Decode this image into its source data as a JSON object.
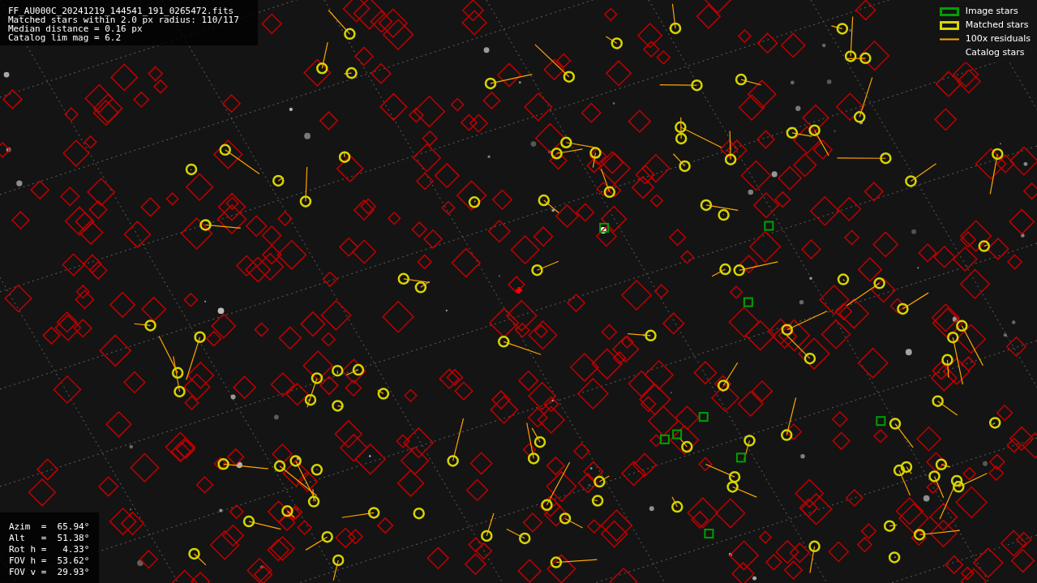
{
  "info": {
    "lines": [
      "FF_AU000C_20241219_144541_191_0265472.fits",
      "Matched stars within 2.0 px radius: 110/117",
      "Median distance = 0.16 px",
      "Catalog lim mag = 6.2"
    ]
  },
  "legend": [
    {
      "kind": "image",
      "label": "Image stars"
    },
    {
      "kind": "matched",
      "label": "Matched stars"
    },
    {
      "kind": "residual",
      "label": "100x residuals"
    },
    {
      "kind": "catalog",
      "label": "Catalog stars"
    }
  ],
  "pointing": {
    "lines": [
      "Azim  =  65.94°",
      "Alt   =  51.38°",
      "Rot h =   4.33°",
      "FOV h =  53.62°",
      "FOV v =  29.93°"
    ]
  }
}
